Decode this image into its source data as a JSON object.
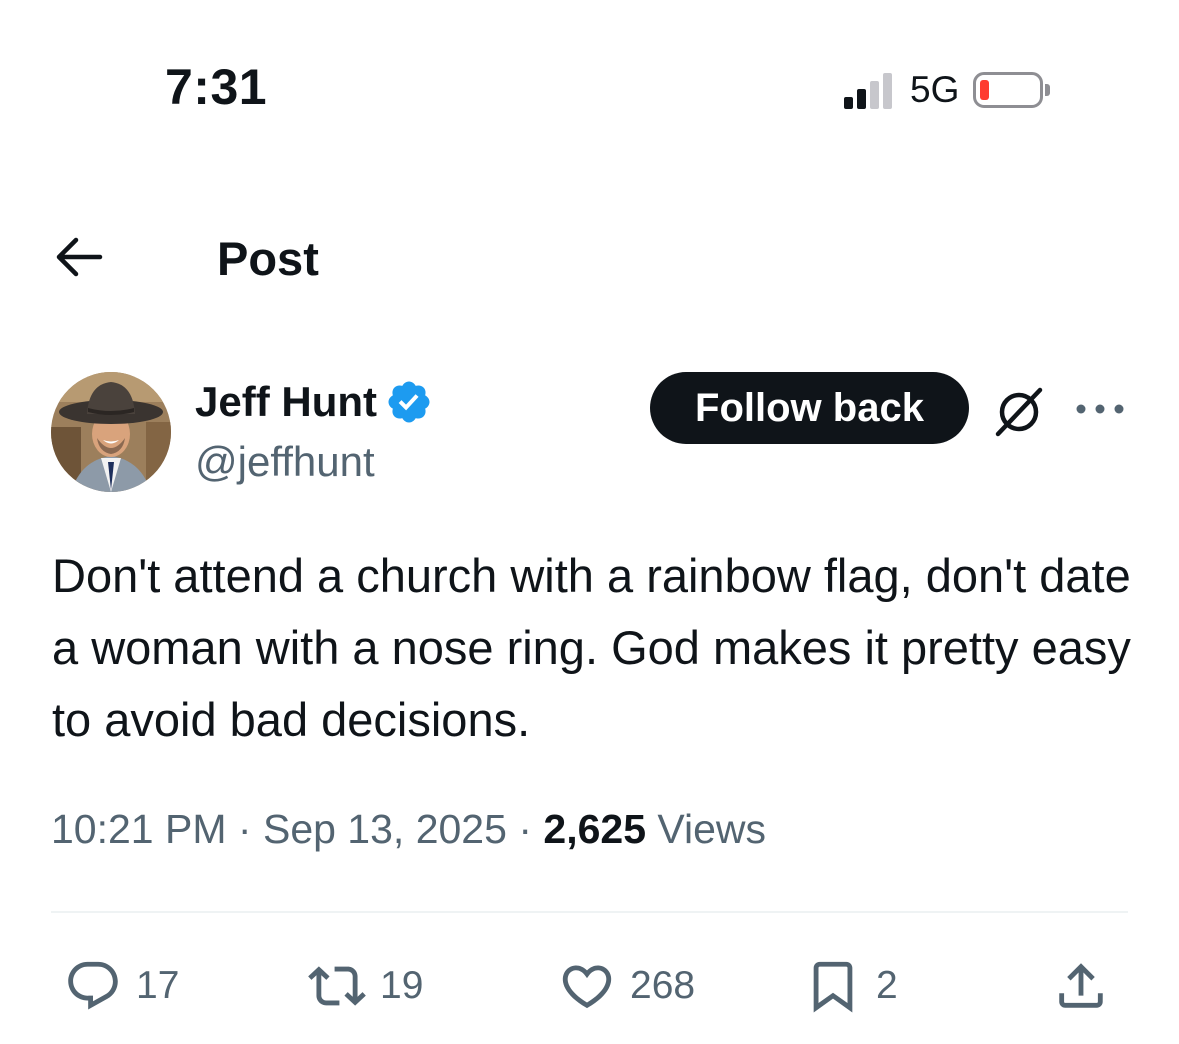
{
  "status_bar": {
    "time": "7:31",
    "network": "5G",
    "signal_bars_active": 2,
    "signal_bars_total": 4,
    "battery_level": "low"
  },
  "header": {
    "title": "Post"
  },
  "author": {
    "name": "Jeff Hunt",
    "handle": "@jeffhunt",
    "verified": true,
    "follow_label": "Follow back"
  },
  "post": {
    "text": "Don't attend a church with a rainbow flag, don't date a woman with a nose ring. God makes it pretty easy to avoid bad decisions.",
    "time": "10:21 PM",
    "separator": "·",
    "date": "Sep 13, 2025",
    "views_count": "2,625",
    "views_label": "Views"
  },
  "actions": {
    "replies": "17",
    "reposts": "19",
    "likes": "268",
    "bookmarks": "2"
  },
  "icons": [
    "back-arrow-icon",
    "verified-badge-icon",
    "grok-icon",
    "more-icon",
    "reply-icon",
    "repost-icon",
    "like-icon",
    "bookmark-icon",
    "share-icon"
  ],
  "colors": {
    "text": "#0f1419",
    "secondary": "#536471",
    "verified": "#1d9bf0",
    "battery_low": "#ff3b30",
    "button_bg": "#0f1419"
  }
}
